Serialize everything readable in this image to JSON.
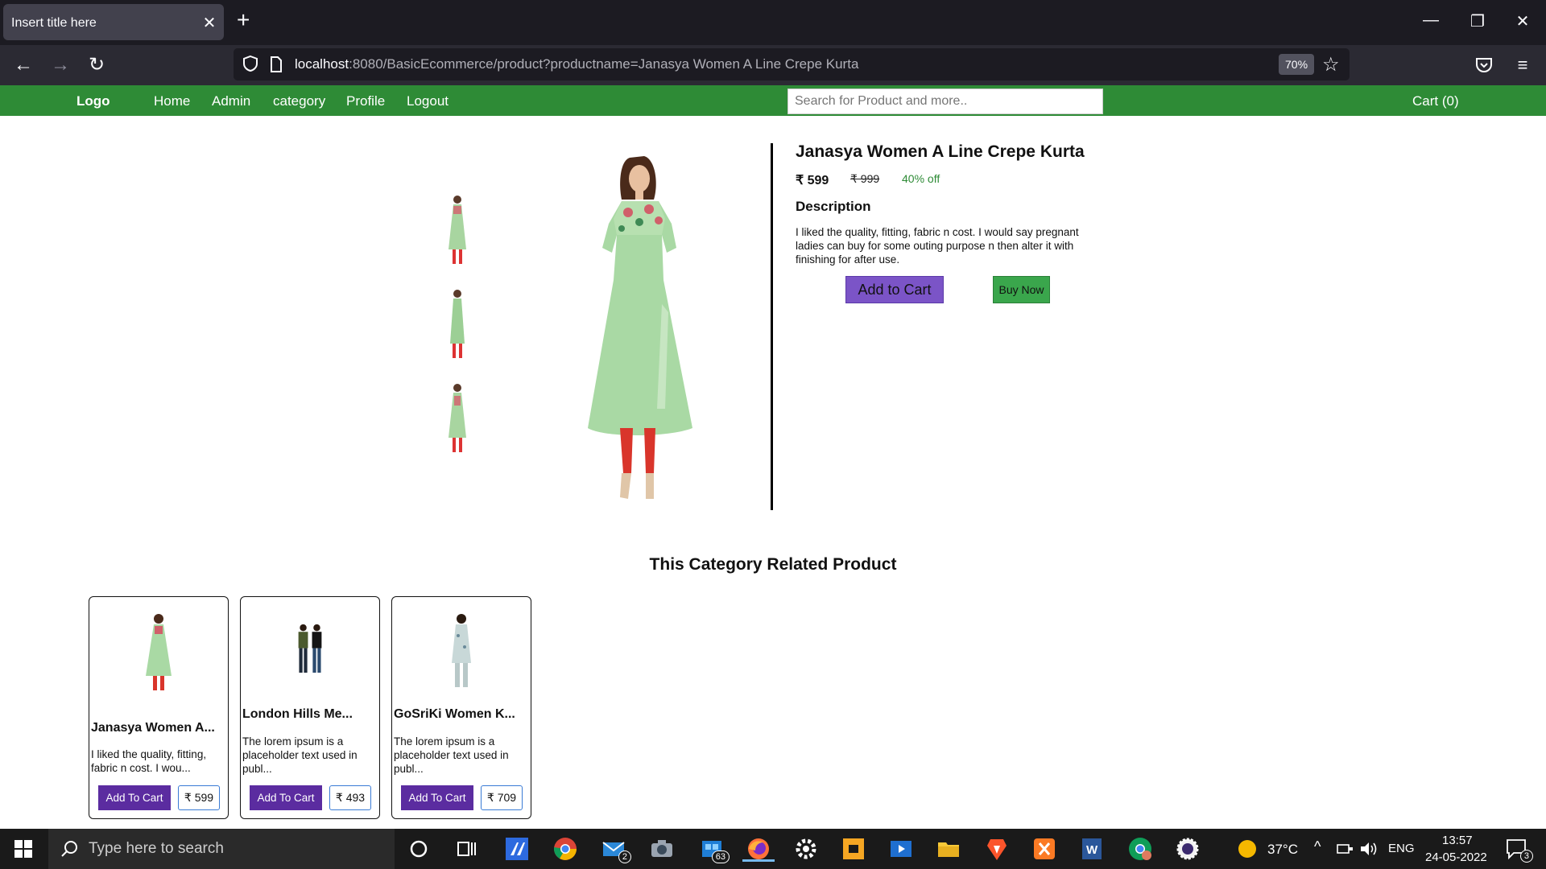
{
  "browser": {
    "tab_title": "Insert title here",
    "url_host": "localhost",
    "url_rest": ":8080/BasicEcommerce/product?productname=Janasya Women A Line Crepe Kurta",
    "zoom": "70%"
  },
  "site": {
    "logo": "Logo",
    "nav": [
      "Home",
      "Admin",
      "category",
      "Profile",
      "Logout"
    ],
    "search_placeholder": "Search for Product and more..",
    "cart": "Cart (0)"
  },
  "product": {
    "title": "Janasya Women A Line Crepe Kurta",
    "price": "₹ 599",
    "mrp": "₹ 999",
    "discount": "40% off",
    "description_heading": "Description",
    "description": "I liked the quality, fitting, fabric n cost. I would say pregnant ladies can buy for some outing purpose n then alter it with finishing for after use.",
    "add_to_cart": "Add to Cart",
    "buy_now": "Buy Now"
  },
  "related": {
    "heading": "This Category Related Product",
    "items": [
      {
        "title": "Janasya Women A...",
        "desc": "I liked the quality, fitting, fabric n cost. I wou...",
        "button": "Add To Cart",
        "price": "₹ 599"
      },
      {
        "title": "London Hills Me...",
        "desc": "The lorem ipsum is a placeholder text used in publ...",
        "button": "Add To Cart",
        "price": "₹ 493"
      },
      {
        "title": "GoSriKi Women K...",
        "desc": "The lorem ipsum is a placeholder text used in publ...",
        "button": "Add To Cart",
        "price": "₹ 709"
      }
    ]
  },
  "taskbar": {
    "search_placeholder": "Type here to search",
    "mail_badge": "2",
    "store_badge": "63",
    "temperature": "37°C",
    "language": "ENG",
    "time": "13:57",
    "date": "24-05-2022",
    "notification_count": "3"
  },
  "colors": {
    "site_header": "#2e8b36",
    "add_to_cart": "#7b54c7",
    "buy_now": "#3aa64c",
    "card_button": "#5b2ca0",
    "discount": "#2e8b36"
  }
}
